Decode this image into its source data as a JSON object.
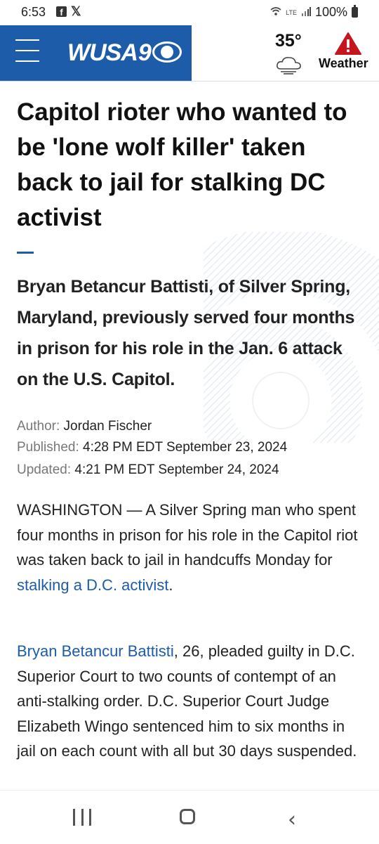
{
  "status_bar": {
    "time": "6:53",
    "notification_icons": [
      "facebook-icon",
      "x-icon"
    ],
    "battery": "100%",
    "status_icons": [
      "wifi-icon",
      "volte-icon",
      "signal-icon",
      "battery-icon"
    ]
  },
  "header": {
    "brand": "WUSA",
    "brand_color": "#1d5ca9",
    "weather_temp": "35°",
    "weather_label": "Weather",
    "alert_color": "#c4161c"
  },
  "article": {
    "headline": "Capitol rioter who wanted to be 'lone wolf killer' taken back to jail for stalking DC activist",
    "subheadline": "Bryan Betancur Battisti, of Silver Spring, Maryland, previously served four months in prison for his role in the Jan. 6 attack on the U.S. Capitol.",
    "author_label": "Author:",
    "author": "Jordan Fischer",
    "published_label": "Published:",
    "published": "4:28 PM EDT September 23, 2024",
    "updated_label": "Updated:",
    "updated": "4:21 PM EDT September 24, 2024",
    "p1_text": "WASHINGTON — A Silver Spring man who spent four months in prison for his role in the Capitol riot was taken back to jail in handcuffs Monday for ",
    "p1_link": "stalking a D.C. activist",
    "p1_end": ".",
    "p2_link": "Bryan Betancur Battisti",
    "p2_text": ", 26, pleaded guilty in D.C. Superior Court to two counts of contempt of an anti-stalking order. D.C. Superior Court Judge Elizabeth Wingo sentenced him to six months in jail on each count with all but 30 days suspended."
  },
  "nav_bar": {
    "buttons": [
      "recent-apps-icon",
      "home-icon",
      "back-icon"
    ]
  }
}
